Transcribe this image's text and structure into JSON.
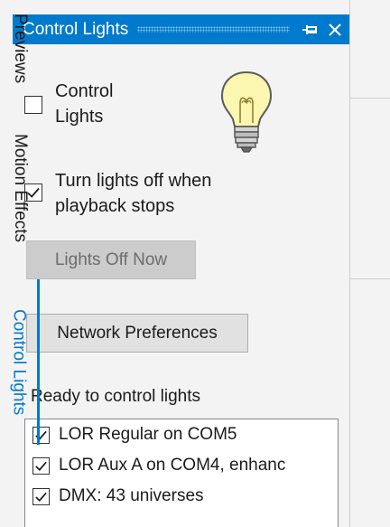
{
  "panel": {
    "title": "Control Lights",
    "pin_icon": "pin-icon",
    "close_icon": "close-icon",
    "bulb_icon": "lightbulb-icon"
  },
  "options": {
    "control_lights": {
      "label_line1": "Control",
      "label_line2": "Lights",
      "checked": false
    },
    "turn_off": {
      "label_line1": "Turn lights off when",
      "label_line2": "playback stops",
      "checked": true
    }
  },
  "buttons": {
    "lights_off_now": "Lights Off Now",
    "network_preferences": "Network Preferences"
  },
  "status": "Ready to control lights",
  "networks": [
    {
      "label": "LOR Regular on COM5",
      "checked": true
    },
    {
      "label": "LOR Aux A on COM4, enhanc",
      "checked": true
    },
    {
      "label": "DMX: 43 universes",
      "checked": true
    }
  ],
  "tabs": [
    {
      "label": "Previews",
      "active": false
    },
    {
      "label": "Motion Effects",
      "active": false
    },
    {
      "label": "Control Lights",
      "active": true
    }
  ],
  "colors": {
    "accent": "#007acc",
    "panel_bg": "#f3f3f3",
    "disabled_button": "#cccccc"
  }
}
